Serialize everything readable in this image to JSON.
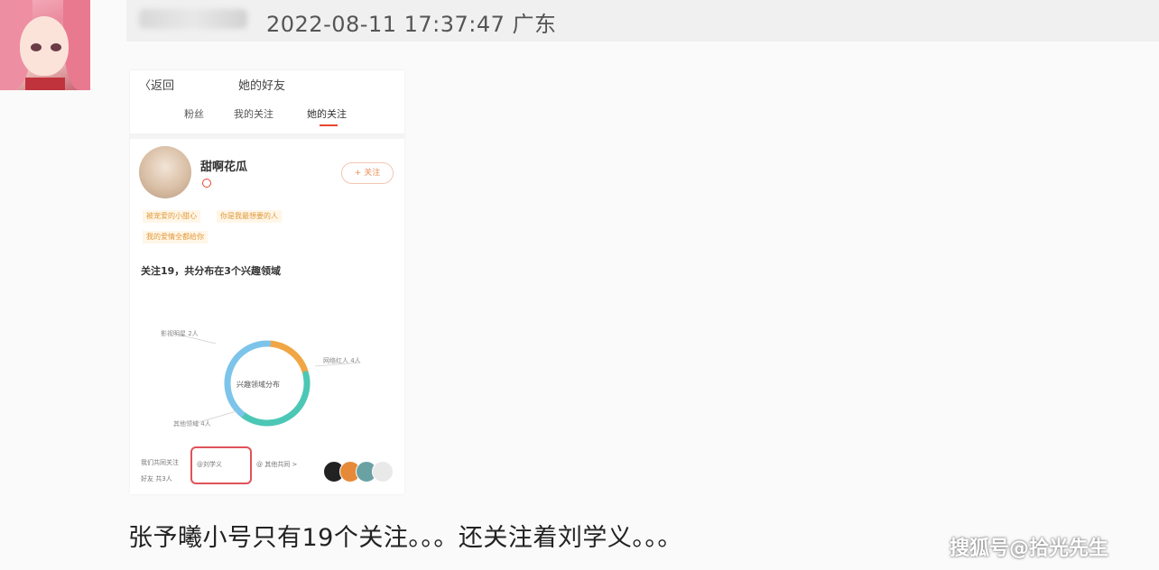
{
  "post": {
    "timestamp": "2022-08-11 17:37:47",
    "location": "广东",
    "caption": "张予曦小号只有19个关注。。。还关注着刘学义。。。"
  },
  "screenshot": {
    "nav": {
      "back": "〈返回",
      "title": "她的好友"
    },
    "tabs": [
      {
        "label": "粉丝"
      },
      {
        "label": "我的关注"
      },
      {
        "label": "她的关注",
        "active": true
      }
    ],
    "profile": {
      "name": "甜啊花瓜",
      "follow_button": "+ 关注",
      "tags": [
        "被宠爱的小甜心",
        "你是我最想要的人",
        "我的爱情全都给你"
      ],
      "follow_summary": "关注19，共分布在3个兴趣领域"
    },
    "chart": {
      "center_label": "兴趣领域分布",
      "segment_labels": [
        "影视明星 2人",
        "网络红人 4人",
        "其他领域 4人"
      ]
    },
    "bottom": {
      "left_line1": "我们共同关注",
      "left_line2": "好友 共3人",
      "boxed_name": "@刘学义",
      "right_text": "@ 其他共同 >"
    }
  },
  "watermark": "搜狐号@拾光先生",
  "chart_data": {
    "type": "pie",
    "title": "兴趣领域分布",
    "categories": [
      "影视明星",
      "网络红人",
      "其他领域"
    ],
    "values": [
      2,
      4,
      4
    ],
    "colors": [
      "#f0a644",
      "#4cc7b5",
      "#7cc4ea"
    ]
  }
}
